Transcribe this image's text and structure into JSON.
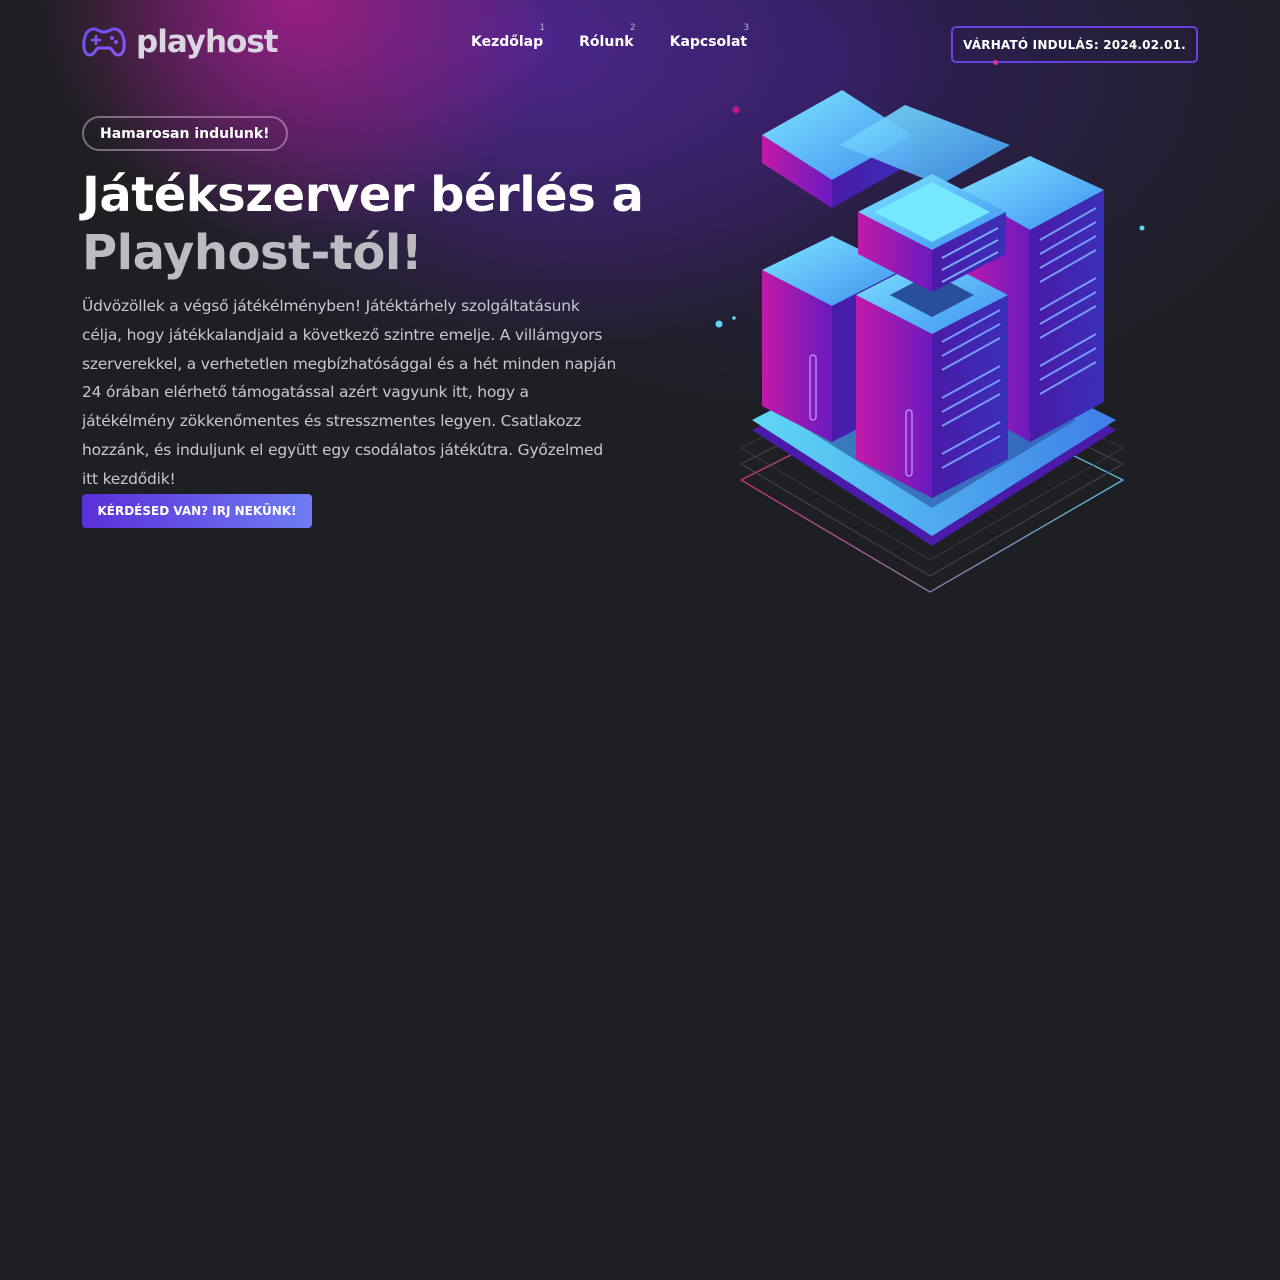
{
  "brand": {
    "name": "playhost",
    "icon": "gamepad-icon"
  },
  "nav": {
    "items": [
      {
        "label": "Kezdőlap",
        "number": "1"
      },
      {
        "label": "Rólunk",
        "number": "2"
      },
      {
        "label": "Kapcsolat",
        "number": "3"
      }
    ]
  },
  "launch_badge": {
    "label": "VÁRHATÓ INDULÁS: 2024.02.01."
  },
  "hero": {
    "pill": "Hamarosan indulunk!",
    "title_line1": "Játékszerver bérlés a",
    "title_line2": "Playhost-tól!",
    "description": "Üdvözöllek a végső játékélményben! Játéktárhely szolgáltatásunk célja, hogy játékkalandjaid a következő szintre emelje. A villámgyors szerverekkel, a verhetetlen megbízhatósággal és a hét minden napján 24 órában elérhető támogatással azért vagyunk itt, hogy a játékélmény zökkenőmentes és stresszmentes legyen. Csatlakozz hozzánk, és induljunk el együtt egy csodálatos játékútra. Győzelmed itt kezdődik!",
    "cta_label": "KÉRDÉSED VAN? IRJ NEKÜNK!"
  },
  "illustration": {
    "icon": "server-rack-icon"
  },
  "colors": {
    "background": "#1e1f23",
    "accent_purple": "#6c3fe0",
    "accent_pink": "#e0328f",
    "accent_cyan": "#5fd8f5"
  }
}
